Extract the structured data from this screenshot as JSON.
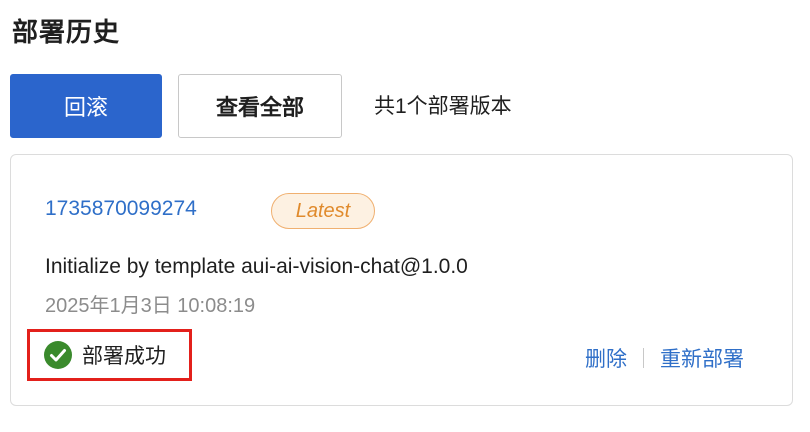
{
  "page": {
    "title": "部署历史"
  },
  "toolbar": {
    "rollback_label": "回滚",
    "view_all_label": "查看全部",
    "version_count": "共1个部署版本"
  },
  "deployment": {
    "id": "1735870099274",
    "badge": "Latest",
    "message": "Initialize by template aui-ai-vision-chat@1.0.0",
    "time": "2025年1月3日 10:08:19",
    "status": {
      "icon": "check-circle-icon",
      "label": "部署成功",
      "color": "#3a8a2c"
    },
    "actions": {
      "delete_label": "删除",
      "redeploy_label": "重新部署"
    }
  },
  "colors": {
    "primary": "#2b65cc",
    "link": "#2f6fc8",
    "badge_text": "#e08a2c",
    "highlight_border": "#e3201b"
  }
}
